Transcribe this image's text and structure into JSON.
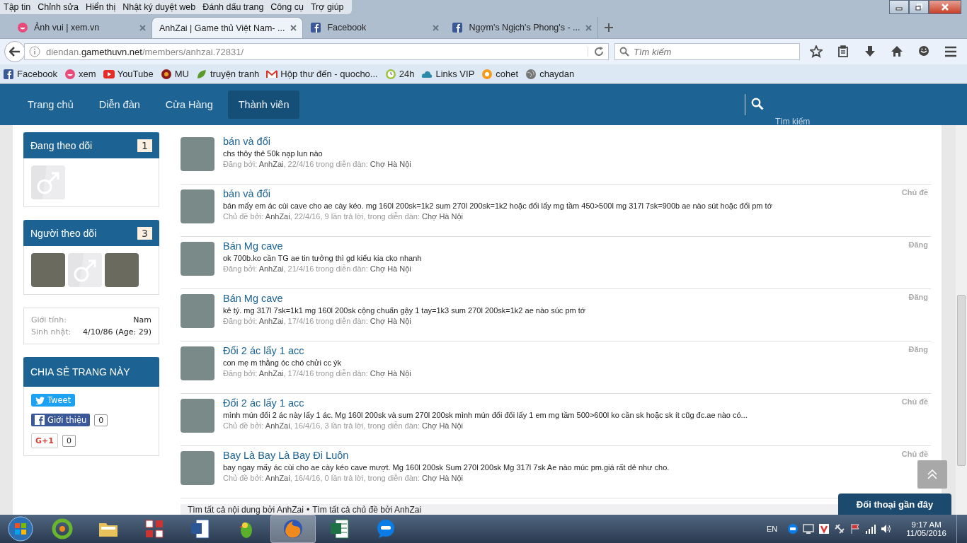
{
  "menu_bar": [
    "Tập tin",
    "Chỉnh sửa",
    "Hiển thị",
    "Nhật ký duyệt web",
    "Đánh dấu trang",
    "Công cụ",
    "Trợ giúp"
  ],
  "tabs": [
    {
      "title": "Ảnh vui | xem.vn",
      "selected": false
    },
    {
      "title": "AnhZai | Game thủ Việt Nam- ...",
      "selected": true
    },
    {
      "title": "Facebook",
      "selected": false
    },
    {
      "title": "Ngợm's Ngịch's Phong's - ...",
      "selected": false
    }
  ],
  "address": {
    "prefix": "diendan.",
    "host": "gamethuvn.net",
    "path": "/members/anhzai.72831/"
  },
  "browser_search": {
    "placeholder": "Tìm kiếm"
  },
  "bookmarks": [
    {
      "label": "Facebook"
    },
    {
      "label": "xem"
    },
    {
      "label": "YouTube"
    },
    {
      "label": "MU"
    },
    {
      "label": "truyện tranh"
    },
    {
      "label": "Hộp thư đến - quocho..."
    },
    {
      "label": "24h"
    },
    {
      "label": "Links VIP"
    },
    {
      "label": "cohet"
    },
    {
      "label": "chaydan"
    }
  ],
  "site_nav": [
    {
      "label": "Trang chủ",
      "selected": false
    },
    {
      "label": "Diễn đàn",
      "selected": false
    },
    {
      "label": "Cửa Hàng",
      "selected": false
    },
    {
      "label": "Thành viên",
      "selected": true
    }
  ],
  "site_search": {
    "label": "Tìm kiếm"
  },
  "following": {
    "title": "Đang theo dõi",
    "count": "1",
    "avatars": [
      {
        "kind": "default"
      }
    ]
  },
  "followers": {
    "title": "Người theo dõi",
    "count": "3",
    "avatars": [
      {
        "kind": "photo"
      },
      {
        "kind": "default"
      },
      {
        "kind": "photo"
      }
    ]
  },
  "profile_info": [
    {
      "label": "Giới tính:",
      "value": "Nam"
    },
    {
      "label": "Sinh nhật:",
      "value": "4/10/86 (Age: 29)"
    }
  ],
  "share": {
    "title": "CHIA SẺ TRANG NÀY",
    "tweet": "Tweet",
    "facebook_like": "Giới thiệu",
    "facebook_count": "0",
    "google_plus": "G+1",
    "google_count": "0"
  },
  "posts": [
    {
      "title": "bán và đổi",
      "snippet": "chs thôy thẻ 50k nạp lun nào",
      "meta_prefix": "Đăng bởi:",
      "author": "AnhZai",
      "meta_middle": ", 22/4/16 trong diễn đàn:",
      "forum": "Chợ Hà Nội"
    },
    {
      "title": "bán và đổi",
      "snippet": "bán mấy em ác cùi cave cho ae cày kéo. mg 160l 200sk=1k2 sum 270l 200sk=1k2 hoặc đổi lấy mg tầm 450>500l mg 317l 7sk=900b ae nào sút hoặc đổi pm tớ",
      "meta_prefix": "Chủ đề bởi:",
      "author": "AnhZai",
      "meta_middle": ", 22/4/16, 9 lần trả lời, trong diễn đàn:",
      "forum": "Chợ Hà Nội",
      "type_label": "Chủ đề"
    },
    {
      "title": "Bán Mg cave",
      "snippet": "ok 700b.ko cần TG ae tin tưởng thì gd kiểu kia cko nhanh",
      "meta_prefix": "Đăng bởi:",
      "author": "AnhZai",
      "meta_middle": ", 21/4/16 trong diễn đàn:",
      "forum": "Chợ Hà Nội",
      "type_label": "Đăng"
    },
    {
      "title": "Bán Mg cave",
      "snippet": "kê tý. mg 317l 7sk=1k1 mg 160l 200sk cộng chuẩn gậy 1 tay=1k3 sum 270l 200sk=1k2 ae nào súc pm tớ",
      "meta_prefix": "Đăng bởi:",
      "author": "AnhZai",
      "meta_middle": ", 17/4/16 trong diễn đàn:",
      "forum": "Chợ Hà Nội",
      "type_label": "Đăng"
    },
    {
      "title": "Đổi 2 ác lấy 1 acc",
      "snippet": "con mẹ m thằng óc chó chửi cc ýk",
      "meta_prefix": "Đăng bởi:",
      "author": "AnhZai",
      "meta_middle": ", 17/4/16 trong diễn đàn:",
      "forum": "Chợ Hà Nội",
      "type_label": "Đăng"
    },
    {
      "title": "Đổi 2 ác lấy 1 acc",
      "snippet": "mình mún đổi 2 ác này lấy 1 ác. Mg 160l 200sk và sum 270l 200sk mình mún đổi đổi lấy 1 em mg tầm 500>600l ko cần sk hoặc sk ít cũg đc.ae nào có...",
      "meta_prefix": "Chủ đề bởi:",
      "author": "AnhZai",
      "meta_middle": ", 16/4/16, 3 lần trả lời, trong diễn đàn:",
      "forum": "Chợ Hà Nội",
      "type_label": "Chủ đề"
    },
    {
      "title": "Bay Là Bay Là Bay Đi Luôn",
      "snippet": "bay ngay mấy ác cùi cho ae cày kéo cave mượt. Mg 160l 200sk Sum 270l 200sk Mg 317l 7sk Ae nào múc pm.giá rất dẻ như cho.",
      "meta_prefix": "Chủ đề bởi:",
      "author": "AnhZai",
      "meta_middle": ", 16/4/16, 0 lần trả lời, trong diễn đàn:",
      "forum": "Chợ Hà Nội",
      "type_label": "Chủ đề"
    }
  ],
  "footer_links": [
    {
      "label": "Tìm tất cả nội dung bởi AnhZai"
    },
    {
      "label": "Tìm tất cả chủ đề bởi AnhZai"
    }
  ],
  "footer_separator": "•",
  "chat_button": "Đối thoại gần đây",
  "taskbar": {
    "apps": [
      {
        "kind": "circle",
        "selected": false
      },
      {
        "kind": "folder",
        "selected": false
      },
      {
        "kind": "tiles",
        "selected": false
      },
      {
        "kind": "document",
        "selected": false
      },
      {
        "kind": "bird",
        "selected": false
      },
      {
        "kind": "globe",
        "selected": true
      },
      {
        "kind": "sheet",
        "selected": false
      },
      {
        "kind": "chat",
        "selected": false
      }
    ],
    "language": "EN",
    "time": "9:17 AM",
    "date": "11/05/2016"
  }
}
